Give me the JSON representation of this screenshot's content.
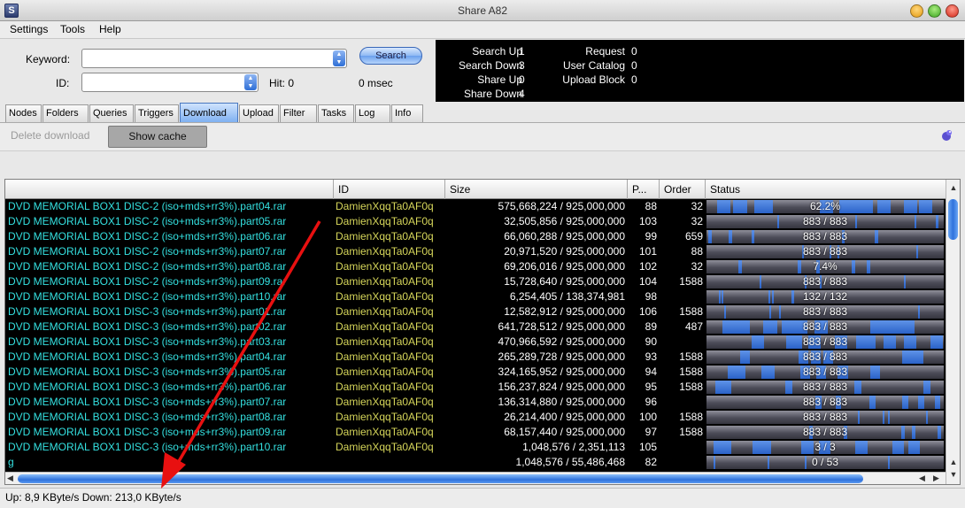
{
  "window": {
    "title": "Share A82"
  },
  "menu": [
    "Settings",
    "Tools",
    "Help"
  ],
  "search": {
    "keyword_label": "Keyword:",
    "keyword_value": "",
    "id_label": "ID:",
    "id_value": "",
    "search_button": "Search",
    "hit_label": "Hit: 0",
    "time_label": "0 msec"
  },
  "stats": {
    "left": [
      {
        "label": "Search Up",
        "value": "1"
      },
      {
        "label": "Search Down",
        "value": "3"
      },
      {
        "label": "Share Up",
        "value": "0"
      },
      {
        "label": "Share Down",
        "value": "4"
      }
    ],
    "right": [
      {
        "label": "Request",
        "value": "0"
      },
      {
        "label": "User Catalog",
        "value": "0"
      },
      {
        "label": "Upload Block",
        "value": "0"
      }
    ]
  },
  "tabs": [
    "Nodes",
    "Folders",
    "Queries",
    "Triggers",
    "Download",
    "Upload",
    "Filter",
    "Tasks",
    "Log",
    "Info"
  ],
  "active_tab": "Download",
  "toolbar": {
    "delete_label": "Delete download",
    "show_cache_label": "Show cache"
  },
  "table": {
    "columns": [
      "",
      "ID",
      "Size",
      "P...",
      "Order",
      "Status"
    ],
    "rows": [
      {
        "name": "DVD MEMORIAL BOX1 DISC-2 (iso+mds+rr3%).part04.rar",
        "id": "DamienXqqTa0AF0q",
        "size": "575,668,224 / 925,000,000",
        "p": "88",
        "order": "32",
        "status": "62.2%",
        "progress": 0.622
      },
      {
        "name": "DVD MEMORIAL BOX1 DISC-2 (iso+mds+rr3%).part05.rar",
        "id": "DamienXqqTa0AF0q",
        "size": "32,505,856 / 925,000,000",
        "p": "103",
        "order": "32",
        "status": "883 / 883",
        "progress": 0.035
      },
      {
        "name": "DVD MEMORIAL BOX1 DISC-2 (iso+mds+rr3%).part06.rar",
        "id": "DamienXqqTa0AF0q",
        "size": "66,060,288 / 925,000,000",
        "p": "99",
        "order": "659",
        "status": "883 / 883",
        "progress": 0.071
      },
      {
        "name": "DVD MEMORIAL BOX1 DISC-2 (iso+mds+rr3%).part07.rar",
        "id": "DamienXqqTa0AF0q",
        "size": "20,971,520 / 925,000,000",
        "p": "101",
        "order": "88",
        "status": "883 / 883",
        "progress": 0.023
      },
      {
        "name": "DVD MEMORIAL BOX1 DISC-2 (iso+mds+rr3%).part08.rar",
        "id": "DamienXqqTa0AF0q",
        "size": "69,206,016 / 925,000,000",
        "p": "102",
        "order": "32",
        "status": "7.4%",
        "progress": 0.074
      },
      {
        "name": "DVD MEMORIAL BOX1 DISC-2 (iso+mds+rr3%).part09.rar",
        "id": "DamienXqqTa0AF0q",
        "size": "15,728,640 / 925,000,000",
        "p": "104",
        "order": "1588",
        "status": "883 / 883",
        "progress": 0.017
      },
      {
        "name": "DVD MEMORIAL BOX1 DISC-2 (iso+mds+rr3%).part10.rar",
        "id": "DamienXqqTa0AF0q",
        "size": "6,254,405 / 138,374,981",
        "p": "98",
        "order": "",
        "status": "132 / 132",
        "progress": 0.045
      },
      {
        "name": "DVD MEMORIAL BOX1 DISC-3 (iso+mds+rr3%).part01.rar",
        "id": "DamienXqqTa0AF0q",
        "size": "12,582,912 / 925,000,000",
        "p": "106",
        "order": "1588",
        "status": "883 / 883",
        "progress": 0.014
      },
      {
        "name": "DVD MEMORIAL BOX1 DISC-3 (iso+mds+rr3%).part02.rar",
        "id": "DamienXqqTa0AF0q",
        "size": "641,728,512 / 925,000,000",
        "p": "89",
        "order": "487",
        "status": "883 / 883",
        "progress": 0.694
      },
      {
        "name": "DVD MEMORIAL BOX1 DISC-3 (iso+mds+rr3%).part03.rar",
        "id": "DamienXqqTa0AF0q",
        "size": "470,966,592 / 925,000,000",
        "p": "90",
        "order": "",
        "status": "883 / 883",
        "progress": 0.509
      },
      {
        "name": "DVD MEMORIAL BOX1 DISC-3 (iso+mds+rr3%).part04.rar",
        "id": "DamienXqqTa0AF0q",
        "size": "265,289,728 / 925,000,000",
        "p": "93",
        "order": "1588",
        "status": "883 / 883",
        "progress": 0.287
      },
      {
        "name": "DVD MEMORIAL BOX1 DISC-3 (iso+mds+rr3%).part05.rar",
        "id": "DamienXqqTa0AF0q",
        "size": "324,165,952 / 925,000,000",
        "p": "94",
        "order": "1588",
        "status": "883 / 883",
        "progress": 0.35
      },
      {
        "name": "DVD MEMORIAL BOX1 DISC-3 (iso+mds+rr3%).part06.rar",
        "id": "DamienXqqTa0AF0q",
        "size": "156,237,824 / 925,000,000",
        "p": "95",
        "order": "1588",
        "status": "883 / 883",
        "progress": 0.169
      },
      {
        "name": "DVD MEMORIAL BOX1 DISC-3 (iso+mds+rr3%).part07.rar",
        "id": "DamienXqqTa0AF0q",
        "size": "136,314,880 / 925,000,000",
        "p": "96",
        "order": "",
        "status": "883 / 883",
        "progress": 0.147
      },
      {
        "name": "DVD MEMORIAL BOX1 DISC-3 (iso+mds+rr3%).part08.rar",
        "id": "DamienXqqTa0AF0q",
        "size": "26,214,400 / 925,000,000",
        "p": "100",
        "order": "1588",
        "status": "883 / 883",
        "progress": 0.028
      },
      {
        "name": "DVD MEMORIAL BOX1 DISC-3 (iso+mds+rr3%).part09.rar",
        "id": "DamienXqqTa0AF0q",
        "size": "68,157,440 / 925,000,000",
        "p": "97",
        "order": "1588",
        "status": "883 / 883",
        "progress": 0.074
      },
      {
        "name": "DVD MEMORIAL BOX1 DISC-3 (iso+mds+rr3%).part10.rar",
        "id": "DamienXqqTa0AF0q",
        "size": "1,048,576 / 2,351,113",
        "p": "105",
        "order": "",
        "status": "3 / 3",
        "progress": 0.446
      },
      {
        "name": "g",
        "id": "",
        "size": "1,048,576 / 55,486,468",
        "p": "82",
        "order": "",
        "status": "0 / 53",
        "progress": 0.019
      }
    ]
  },
  "status_bar": "Up: 8,9 KByte/s Down: 213,0 KByte/s",
  "colors": {
    "name_text": "#34e0e0",
    "id_text": "#d6d65a",
    "progress_fill": "#2a62c8",
    "annotation_arrow": "#e81010"
  }
}
